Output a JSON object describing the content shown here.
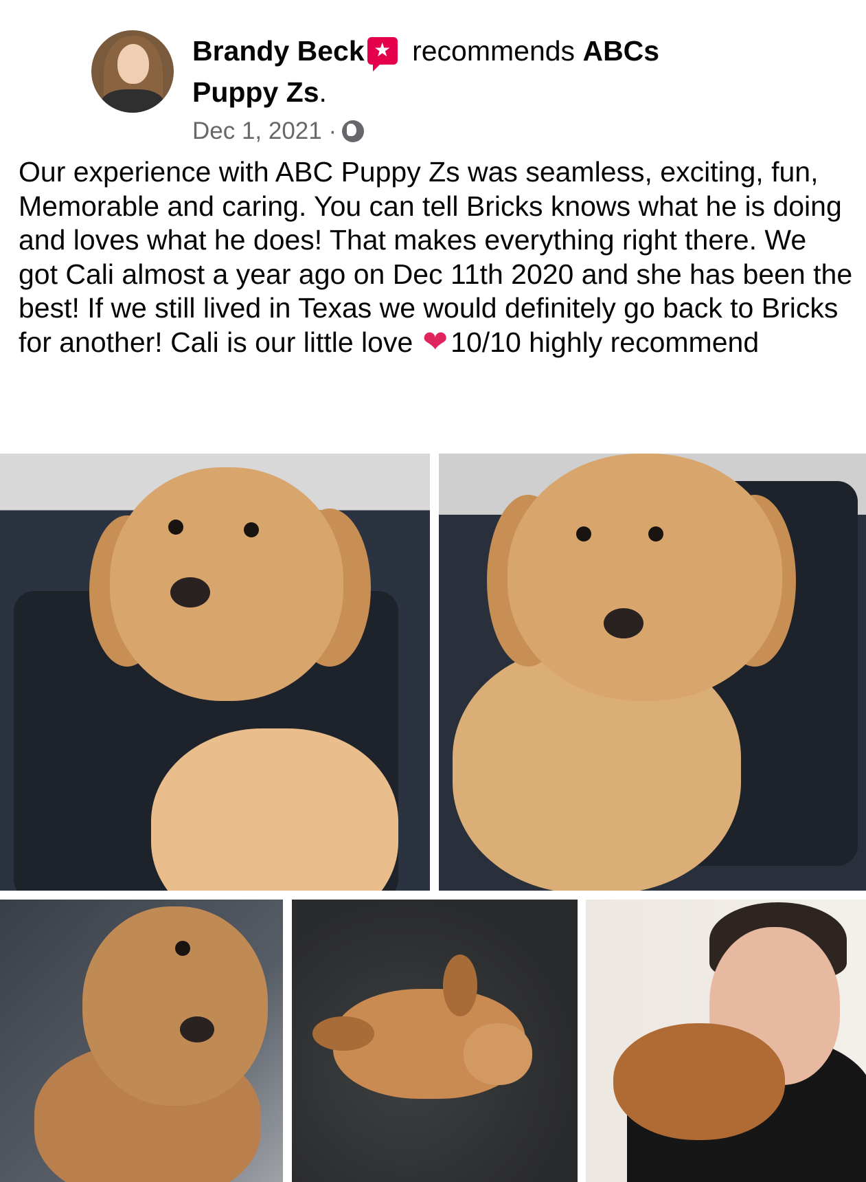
{
  "post": {
    "author": "Brandy Beck",
    "action": "recommends",
    "business_line1": "ABCs",
    "business_line2": "Puppy Zs",
    "title_period": ".",
    "date": "Dec 1, 2021",
    "separator": "·",
    "text_main": "Our experience with ABC Puppy Zs was seamless, exciting, fun, Memorable and caring. You can tell Bricks knows what he is doing and loves what he does! That makes everything right there. We got Cali almost a year ago on Dec 11th 2020 and she has been the best! If we still lived in Texas we would definitely go back to Bricks for another! Cali is our little love",
    "heart_glyph": "❤",
    "text_end": "10/10 highly recommend"
  },
  "icons": {
    "recommendation_badge": "recommendation-badge-icon",
    "audience": "globe-icon",
    "heart": "heart-icon"
  },
  "colors": {
    "badge": "#e4004b",
    "meta_text": "#65676b",
    "heart": "#e0245e"
  }
}
